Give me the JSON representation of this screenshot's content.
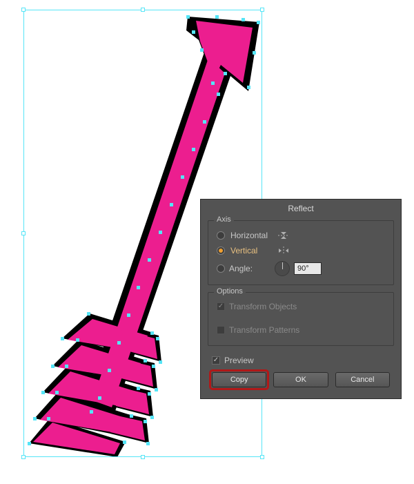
{
  "canvas": {
    "artwork_name": "arrow-vector-selected"
  },
  "dialog": {
    "title": "Reflect",
    "axis": {
      "group_label": "Axis",
      "horizontal_label": "Horizontal",
      "vertical_label": "Vertical",
      "angle_label": "Angle:",
      "angle_value": "90°",
      "selected": "vertical"
    },
    "options": {
      "group_label": "Options",
      "transform_objects_label": "Transform Objects",
      "transform_objects_checked": true,
      "transform_patterns_label": "Transform Patterns",
      "transform_patterns_checked": false
    },
    "preview": {
      "label": "Preview",
      "checked": true
    },
    "buttons": {
      "copy": "Copy",
      "ok": "OK",
      "cancel": "Cancel"
    }
  }
}
